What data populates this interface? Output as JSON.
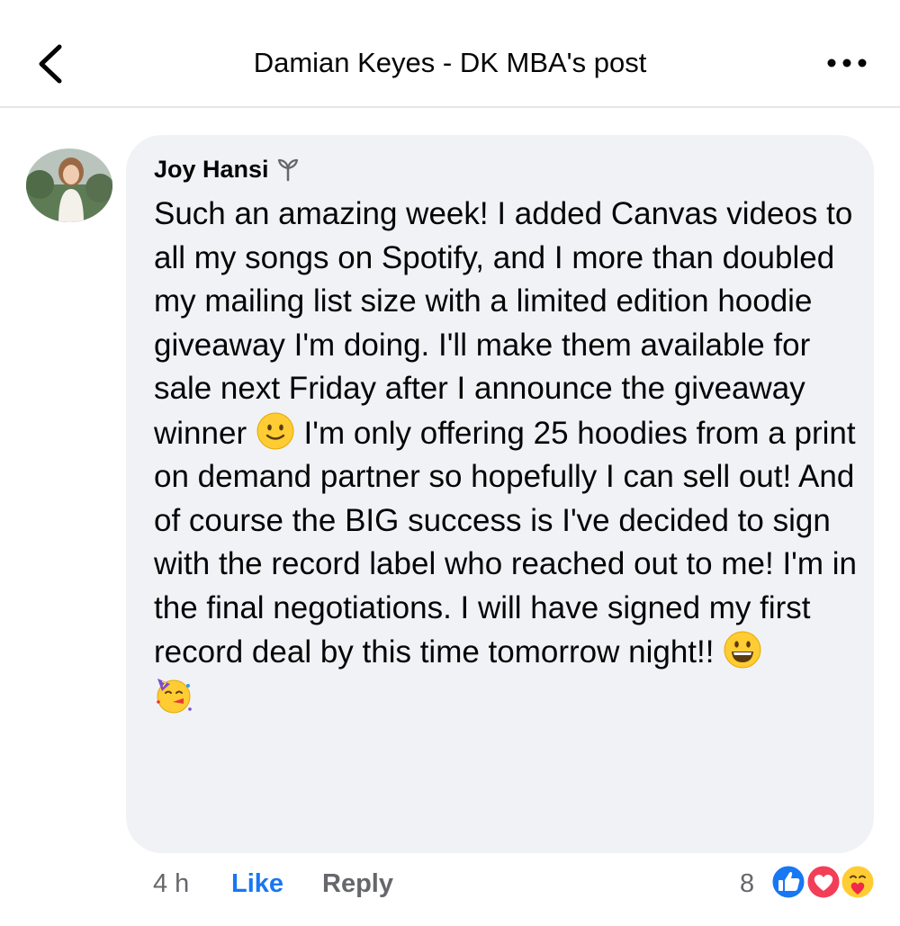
{
  "header": {
    "title": "Damian Keyes - DK MBA's post"
  },
  "comment": {
    "author": "Joy Hansi",
    "text_part1": "Such an amazing week! I added Canvas videos to all my songs on Spotify, and I more than doubled my mailing list size with a limited edition hoodie giveaway I'm doing. I'll make them available for sale next Friday after I announce the giveaway winner ",
    "text_part2": " I'm only offering 25 hoodies from a print on demand partner so hopefully I can sell out! And of course the BIG success is I've decided to sign with the record label who reached out to me! I'm in the final negotiations. I will have signed my first record deal by this time tomorrow night!! "
  },
  "footer": {
    "timestamp": "4 h",
    "like_label": "Like",
    "reply_label": "Reply",
    "reaction_count": "8"
  },
  "colors": {
    "accent": "#1877f2",
    "bubble": "#f0f2f5",
    "secondary_text": "#65676b"
  },
  "icons": [
    "back-chevron-icon",
    "more-options-icon",
    "sprout-badge-icon",
    "slightly-smiling-emoji",
    "grinning-emoji",
    "partying-face-emoji",
    "like-reaction-icon",
    "love-reaction-icon",
    "care-reaction-icon"
  ]
}
